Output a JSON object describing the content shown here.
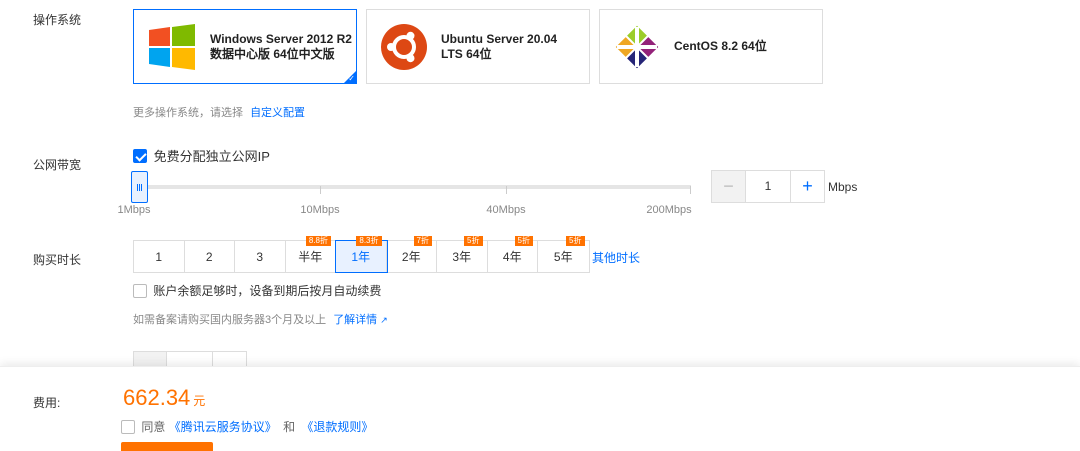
{
  "os": {
    "label": "操作系统",
    "cards": [
      {
        "name": "Windows Server 2012 R2 数据中心版 64位中文版",
        "logo": "windows-icon"
      },
      {
        "name": "Ubuntu Server 20.04 LTS 64位",
        "logo": "ubuntu-icon"
      },
      {
        "name": "CentOS 8.2 64位",
        "logo": "centos-icon"
      }
    ],
    "selected_index": 0,
    "hint_prefix": "更多操作系统，请选择",
    "hint_link": "自定义配置"
  },
  "bandwidth": {
    "label": "公网带宽",
    "public_ip_label": "免费分配独立公网IP",
    "public_ip_checked": true,
    "ticks": [
      "1Mbps",
      "10Mbps",
      "40Mbps",
      "200Mbps"
    ],
    "value": "1",
    "unit": "Mbps",
    "minus_label": "−",
    "plus_label": "+"
  },
  "duration": {
    "label": "购买时长",
    "options": [
      {
        "label": "1",
        "badge": ""
      },
      {
        "label": "2",
        "badge": ""
      },
      {
        "label": "3",
        "badge": ""
      },
      {
        "label": "半年",
        "badge": "8.8折"
      },
      {
        "label": "1年",
        "badge": "8.3折"
      },
      {
        "label": "2年",
        "badge": "7折"
      },
      {
        "label": "3年",
        "badge": "5折"
      },
      {
        "label": "4年",
        "badge": "5折"
      },
      {
        "label": "5年",
        "badge": "5折"
      }
    ],
    "selected_index": 4,
    "other_link": "其他时长",
    "auto_renew_label": "账户余额足够时，设备到期后按月自动续费",
    "auto_renew_checked": false,
    "filing_hint": "如需备案请购买国内服务器3个月及以上",
    "filing_link": "了解详情"
  },
  "footer": {
    "fee_label": "费用:",
    "price": "662.34",
    "price_unit": "元",
    "agree_prefix": "同意",
    "agreement_link": "《腾讯云服务协议》",
    "and_text": "和",
    "refund_link": "《退款规则》"
  },
  "colors": {
    "accent": "#006eff",
    "price": "#ff7200",
    "badge": "#ff7200"
  }
}
